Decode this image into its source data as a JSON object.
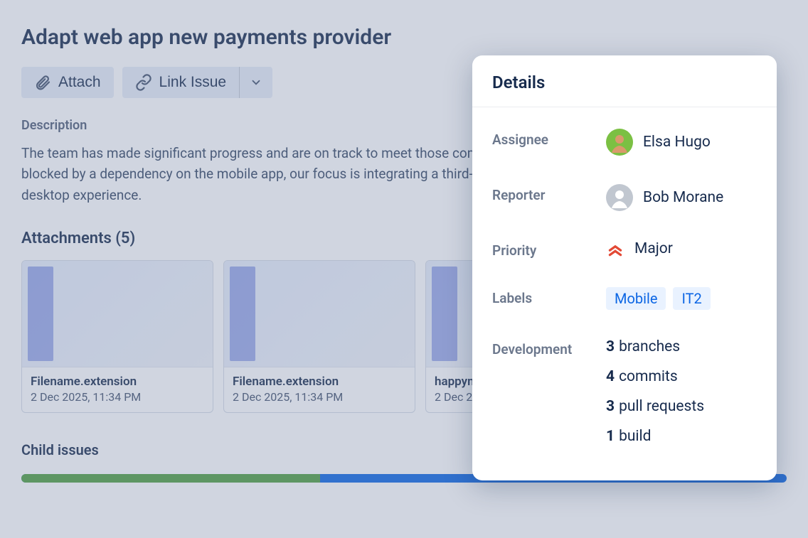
{
  "issue": {
    "title": "Adapt web app new payments provider",
    "toolbar": {
      "attach_label": "Attach",
      "link_issue_label": "Link Issue"
    },
    "description_heading": "Description",
    "description_text": "The team has made significant progress and are on track to meet those commitments. While partially blocked by a dependency on the mobile app, our focus is integrating a third-party payment provider for the desktop experience.",
    "attachments_heading": "Attachments (5)",
    "attachments": [
      {
        "name": "Filename.extension",
        "date": "2 Dec 2025, 11:34 PM"
      },
      {
        "name": "Filename.extension",
        "date": "2 Dec 2025, 11:34 PM"
      },
      {
        "name": "happyn",
        "date": "2 Dec 2"
      }
    ],
    "child_issues_heading": "Child issues",
    "progress_done_pct": 39
  },
  "details": {
    "heading": "Details",
    "assignee_label": "Assignee",
    "assignee_name": "Elsa Hugo",
    "reporter_label": "Reporter",
    "reporter_name": "Bob Morane",
    "priority_label": "Priority",
    "priority_value": "Major",
    "labels_label": "Labels",
    "labels": [
      "Mobile",
      "IT2"
    ],
    "development_label": "Development",
    "development": [
      {
        "count": "3",
        "text": "branches"
      },
      {
        "count": "4",
        "text": "commits"
      },
      {
        "count": "3",
        "text": "pull requests"
      },
      {
        "count": "1",
        "text": "build"
      }
    ]
  }
}
